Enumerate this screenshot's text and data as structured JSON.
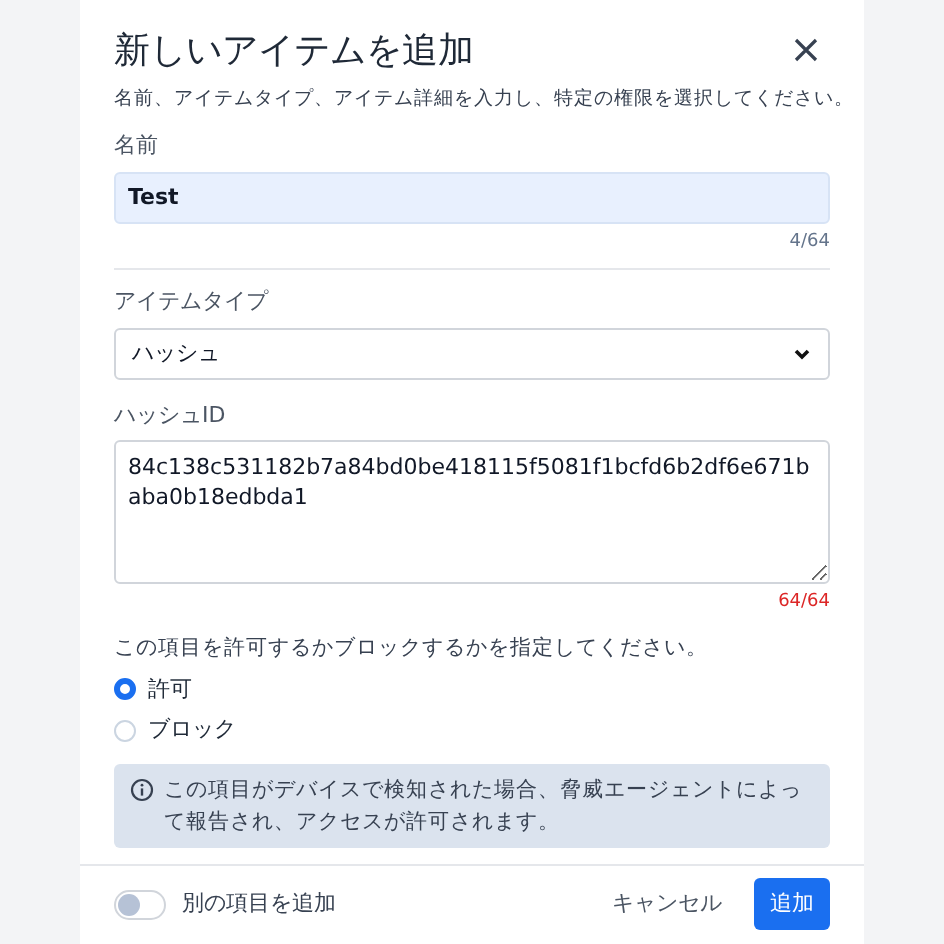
{
  "dialog": {
    "title": "新しいアイテムを追加",
    "description": "名前、アイテムタイプ、アイテム詳細を入力し、特定の権限を選択してください。"
  },
  "name_field": {
    "label": "名前",
    "value": "Test",
    "counter": "4/64",
    "at_limit": false
  },
  "type_field": {
    "label": "アイテムタイプ",
    "value": "ハッシュ"
  },
  "hash_field": {
    "label": "ハッシュID",
    "value": "84c138c531182b7a84bd0be418115f5081f1bcfd6b2df6e671baba0b18edbda1",
    "counter": "64/64",
    "at_limit": true
  },
  "permission": {
    "question": "この項目を許可するかブロックするかを指定してください。",
    "options": [
      {
        "label": "許可",
        "selected": true
      },
      {
        "label": "ブロック",
        "selected": false
      }
    ]
  },
  "info": "この項目がデバイスで検知された場合、脅威エージェントによって報告され、アクセスが許可されます。",
  "footer": {
    "toggle": {
      "label": "別の項目を追加",
      "on": false
    },
    "buttons": [
      {
        "label": "キャンセル",
        "kind": "secondary"
      },
      {
        "label": "追加",
        "kind": "primary"
      }
    ]
  }
}
